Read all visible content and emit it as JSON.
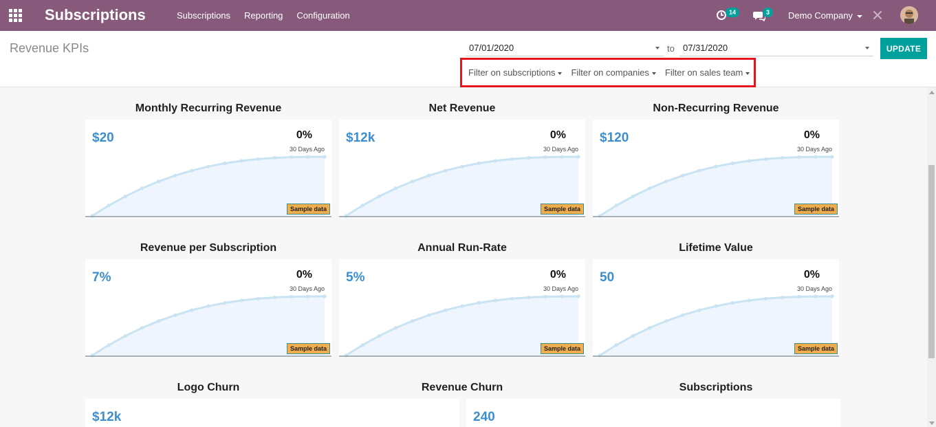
{
  "navbar": {
    "app_name": "Subscriptions",
    "menu": [
      "Subscriptions",
      "Reporting",
      "Configuration"
    ],
    "activity_count": "14",
    "messages_count": "3",
    "company": "Demo Company"
  },
  "control": {
    "title": "Revenue KPIs",
    "date_from": "07/01/2020",
    "date_sep": "to",
    "date_to": "07/31/2020",
    "update_label": "UPDATE",
    "filters": [
      "Filter on subscriptions",
      "Filter on companies",
      "Filter on sales team"
    ]
  },
  "kpis": [
    {
      "title": "Monthly Recurring Revenue",
      "value": "$20",
      "pct": "0%",
      "ago": "30 Days Ago",
      "sample": "Sample data"
    },
    {
      "title": "Net Revenue",
      "value": "$12k",
      "pct": "0%",
      "ago": "30 Days Ago",
      "sample": "Sample data"
    },
    {
      "title": "Non-Recurring Revenue",
      "value": "$120",
      "pct": "0%",
      "ago": "30 Days Ago",
      "sample": "Sample data"
    },
    {
      "title": "Revenue per Subscription",
      "value": "7%",
      "pct": "0%",
      "ago": "30 Days Ago",
      "sample": "Sample data"
    },
    {
      "title": "Annual Run-Rate",
      "value": "5%",
      "pct": "0%",
      "ago": "30 Days Ago",
      "sample": "Sample data"
    },
    {
      "title": "Lifetime Value",
      "value": "50",
      "pct": "0%",
      "ago": "30 Days Ago",
      "sample": "Sample data"
    }
  ],
  "bottom_kpis": [
    {
      "title": "Logo Churn",
      "value": "$12k"
    },
    {
      "title": "Revenue Churn",
      "value": ""
    },
    {
      "title": "Subscriptions",
      "value": "240"
    }
  ],
  "colors": {
    "navbar": "#875a7b",
    "accent": "#00a09d",
    "kpi_value": "#3d8ecf",
    "highlight_box": "#e5151d",
    "sample_badge": "#f0ad4e"
  }
}
